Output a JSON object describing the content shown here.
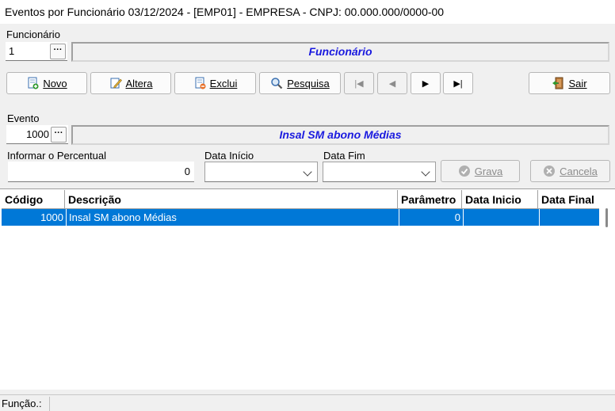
{
  "window": {
    "title": "Eventos por Funcionário 03/12/2024 - [EMP01] - EMPRESA - CNPJ: 00.000.000/0000-00"
  },
  "funcionario": {
    "label": "Funcionário",
    "code": "1",
    "lookup": "···",
    "banner": "Funcionário"
  },
  "toolbar": {
    "novo": "Novo",
    "altera": "Altera",
    "exclui": "Exclui",
    "pesquisa": "Pesquisa",
    "sair": "Sair",
    "first": "|◀",
    "prev": "◀",
    "next": "▶",
    "last": "▶|"
  },
  "evento": {
    "label": "Evento",
    "code": "1000",
    "lookup": "···",
    "banner": "Insal SM abono Médias"
  },
  "percentual": {
    "label": "Informar o Percentual",
    "value": "0"
  },
  "data_inicio": {
    "label": "Data Início",
    "value": ""
  },
  "data_fim": {
    "label": "Data Fim",
    "value": ""
  },
  "actions": {
    "grava": "Grava",
    "cancela": "Cancela"
  },
  "grid": {
    "headers": [
      "Código",
      "Descrição",
      "Parâmetro",
      "Data Inicio",
      "Data Final"
    ],
    "rows": [
      {
        "codigo": "1000",
        "descricao": "Insal SM abono Médias",
        "parametro": "0",
        "data_inicio": "",
        "data_final": ""
      }
    ]
  },
  "status": {
    "funcao_label": "Função.:"
  }
}
